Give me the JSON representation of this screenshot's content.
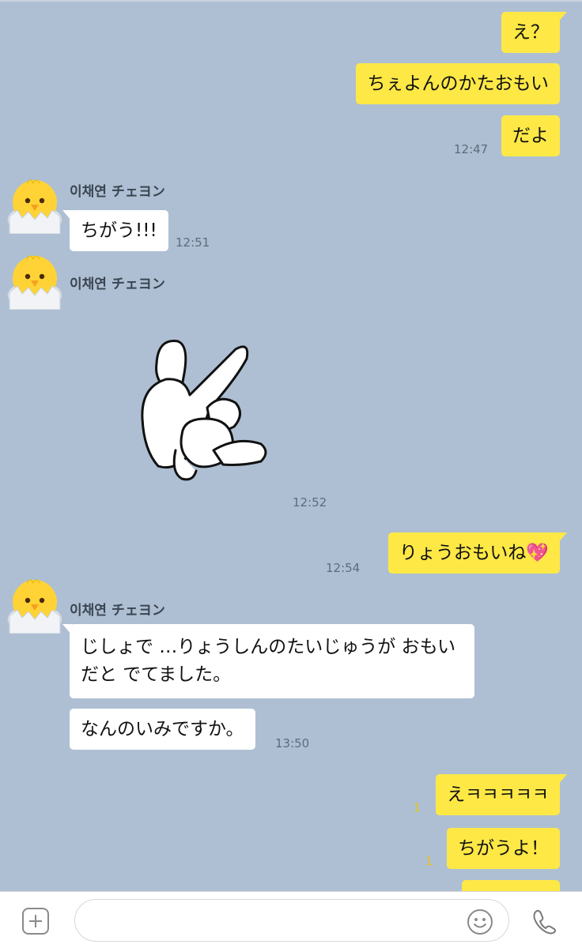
{
  "contact": {
    "name": "이채연 チェヨン"
  },
  "messages": {
    "out1": "え？",
    "out2": "ちぇよんのかたおもい",
    "out3": "だよ",
    "out3_time": "12:47",
    "in1": "ちがう!!!",
    "in1_time": "12:51",
    "sticker_time": "12:52",
    "out4": "りょうおもいね💖",
    "out4_time": "12:54",
    "in2": "じしょで …りょうしんのたいじゅうが おもいだと でてました。",
    "in3": "なんのいみですか。",
    "in3_time": "13:50",
    "out5": "えㅋㅋㅋㅋㅋ",
    "out5_read": "1",
    "out6": "ちがうよ！",
    "out6_read": "1"
  },
  "input": {
    "placeholder": ""
  },
  "colors": {
    "chat_bg": "#aebfd3",
    "outgoing": "#fde846",
    "incoming": "#ffffff"
  },
  "icons": {
    "attach": "plus-icon",
    "emoji": "smiley-icon",
    "call": "phone-icon",
    "avatar": "chick-avatar"
  }
}
